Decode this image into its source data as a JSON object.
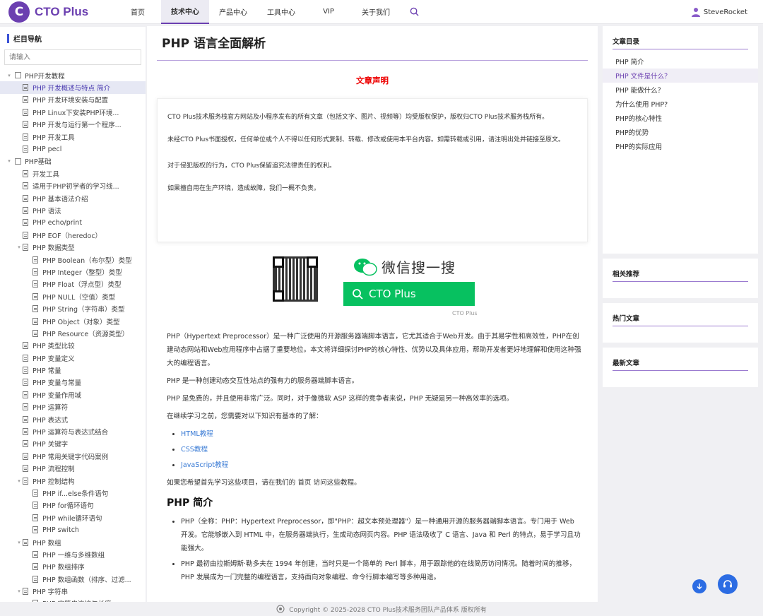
{
  "brand": {
    "name": "CTO Plus",
    "mark": "C"
  },
  "nav": {
    "items": [
      "首页",
      "技术中心",
      "产品中心",
      "工具中心",
      "VIP",
      "关于我们"
    ],
    "user": "SteveRocket"
  },
  "sidebar": {
    "title": "栏目导航",
    "search_placeholder": "请输入",
    "tree": [
      {
        "label": "PHP开发教程",
        "kind": "folder",
        "level": 0
      },
      {
        "label": "PHP 开发概述与特点 简介",
        "kind": "doc",
        "level": 1,
        "active": true
      },
      {
        "label": "PHP 开发环境安装与配置",
        "kind": "doc",
        "level": 1
      },
      {
        "label": "PHP Linux下安装PHP环境...",
        "kind": "doc",
        "level": 1
      },
      {
        "label": "PHP 开发与运行第一个程序...",
        "kind": "doc",
        "level": 1
      },
      {
        "label": "PHP 开发工具",
        "kind": "doc",
        "level": 1
      },
      {
        "label": "PHP pecl",
        "kind": "doc",
        "level": 1
      },
      {
        "label": "PHP基础",
        "kind": "folder",
        "level": 0
      },
      {
        "label": "开发工具",
        "kind": "doc",
        "level": 1
      },
      {
        "label": "适用于PHP初学者的学习线...",
        "kind": "doc",
        "level": 1
      },
      {
        "label": "PHP 基本语法介绍",
        "kind": "doc",
        "level": 1
      },
      {
        "label": "PHP 语法",
        "kind": "doc",
        "level": 1
      },
      {
        "label": "PHP echo/print",
        "kind": "doc",
        "level": 1
      },
      {
        "label": "PHP EOF（heredoc）",
        "kind": "doc",
        "level": 1
      },
      {
        "label": "PHP 数据类型",
        "kind": "doc",
        "level": 1,
        "caret": true
      },
      {
        "label": "PHP Boolean（布尔型）类型",
        "kind": "doc",
        "level": 2
      },
      {
        "label": "PHP Integer（整型）类型",
        "kind": "doc",
        "level": 2
      },
      {
        "label": "PHP Float（浮点型）类型",
        "kind": "doc",
        "level": 2
      },
      {
        "label": "PHP NULL（空值）类型",
        "kind": "doc",
        "level": 2
      },
      {
        "label": "PHP String（字符串）类型",
        "kind": "doc",
        "level": 2
      },
      {
        "label": "PHP Object（对象）类型",
        "kind": "doc",
        "level": 2
      },
      {
        "label": "PHP Resource（资源类型）",
        "kind": "doc",
        "level": 2
      },
      {
        "label": "PHP 类型比较",
        "kind": "doc",
        "level": 1
      },
      {
        "label": "PHP 变量定义",
        "kind": "doc",
        "level": 1
      },
      {
        "label": "PHP 常量",
        "kind": "doc",
        "level": 1
      },
      {
        "label": "PHP 变量与常量",
        "kind": "doc",
        "level": 1
      },
      {
        "label": "PHP 变量作用域",
        "kind": "doc",
        "level": 1
      },
      {
        "label": "PHP 运算符",
        "kind": "doc",
        "level": 1
      },
      {
        "label": "PHP 表达式",
        "kind": "doc",
        "level": 1
      },
      {
        "label": "PHP 运算符与表达式结合",
        "kind": "doc",
        "level": 1
      },
      {
        "label": "PHP 关键字",
        "kind": "doc",
        "level": 1
      },
      {
        "label": "PHP 常用关键字代码案例",
        "kind": "doc",
        "level": 1
      },
      {
        "label": "PHP 流程控制",
        "kind": "doc",
        "level": 1
      },
      {
        "label": "PHP 控制结构",
        "kind": "doc",
        "level": 1,
        "caret": true
      },
      {
        "label": "PHP if...else条件语句",
        "kind": "doc",
        "level": 2
      },
      {
        "label": "PHP for循环语句",
        "kind": "doc",
        "level": 2
      },
      {
        "label": "PHP while循环语句",
        "kind": "doc",
        "level": 2
      },
      {
        "label": "PHP switch",
        "kind": "doc",
        "level": 2
      },
      {
        "label": "PHP 数组",
        "kind": "doc",
        "level": 1,
        "caret": true
      },
      {
        "label": "PHP 一维与多维数组",
        "kind": "doc",
        "level": 2
      },
      {
        "label": "PHP 数组排序",
        "kind": "doc",
        "level": 2
      },
      {
        "label": "PHP 数组函数（排序、过滤...",
        "kind": "doc",
        "level": 2
      },
      {
        "label": "PHP 字符串",
        "kind": "doc",
        "level": 1,
        "caret": true
      },
      {
        "label": "PHP 字符串连接与长度",
        "kind": "doc",
        "level": 2
      }
    ]
  },
  "article": {
    "title": "PHP 语言全面解析",
    "declaration_title": "文章声明",
    "declaration": [
      "CTO Plus技术服务栈官方网站及小程序发布的所有文章（包括文字、图片、视频等）均受版权保护，版权归CTO Plus技术服务栈所有。",
      "未经CTO Plus书面授权，任何单位或个人不得以任何形式复制、转载、修改或使用本平台内容。如需转载或引用，请注明出处并链接至原文。",
      "对于侵犯版权的行为，CTO Plus保留追究法律责任的权利。",
      "如果擅自用在生产环境，造成故障，我们一概不负责。"
    ],
    "wechat_text": "微信搜一搜",
    "wechat_button": "CTO Plus",
    "qr_caption": "CTO Plus",
    "intro": "PHP（Hypertext Preprocessor）是一种广泛使用的开源服务器端脚本语言，它尤其适合于Web开发。由于其易学性和高效性，PHP在创建动态网站和Web应用程序中占据了重要地位。本文将详细探讨PHP的核心特性、优势以及具体应用，帮助开发者更好地理解和使用这种强大的编程语言。",
    "p2": "PHP 是一种创建动态交互性站点的强有力的服务器端脚本语言。",
    "p3": "PHP 是免费的，并且使用非常广泛。同时，对于像微软 ASP 这样的竞争者来说，PHP 无疑是另一种高效率的选项。",
    "p4": "在继续学习之前，您需要对以下知识有基本的了解：",
    "links": [
      "HTML教程",
      "CSS教程",
      "JavaScript教程"
    ],
    "p5": "如果您希望首先学习这些项目，请在我们的 首页 访问这些教程。",
    "h2": "PHP 简介",
    "bullets": [
      "PHP（全称：PHP：Hypertext Preprocessor，即\"PHP：超文本预处理器\"）是一种通用开源的服务器端脚本语言。专门用于 Web 开发。它能够嵌入到 HTML 中，在服务器端执行，生成动态网页内容。PHP 语法吸收了 C 语言、Java 和 Perl 的特点，易于学习且功能强大。",
      "PHP 最初由拉斯姆斯·勒多夫在 1994 年创建，当时只是一个简单的 Perl 脚本，用于跟踪他的在线简历访问情况。随着时间的推移，PHP 发展成为一门完整的编程语言，支持面向对象编程、命令行脚本编写等多种用途。"
    ]
  },
  "toc": {
    "title": "文章目录",
    "items": [
      "PHP 简介",
      "PHP 文件是什么？",
      "PHP 能做什么？",
      "为什么使用 PHP?",
      "PHP的核心特性",
      "PHP的优势",
      "PHP的实际应用"
    ],
    "active_index": 1
  },
  "panels": {
    "related": "相关推荐",
    "hot": "热门文章",
    "latest": "最新文章"
  },
  "footer": {
    "text": "Copyright © 2025-2028 CTO Plus技术服务团队产品体系 版权所有"
  }
}
